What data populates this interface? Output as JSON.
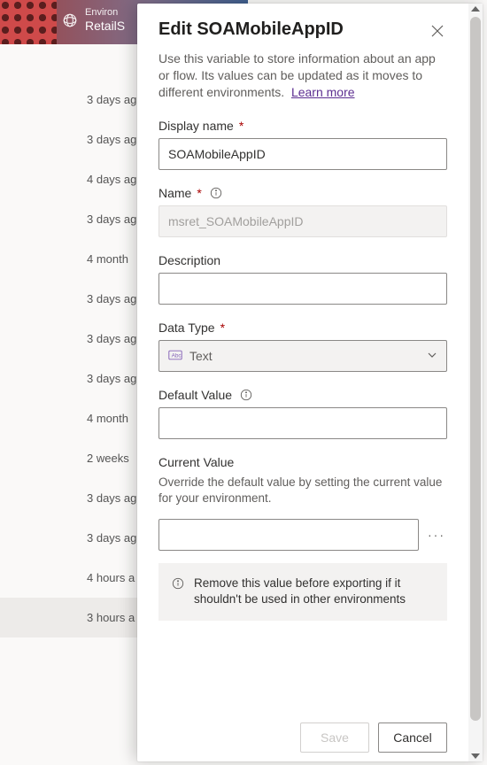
{
  "header": {
    "env_label": "Environ",
    "env_name": "RetailS"
  },
  "bg_rows": [
    {
      "text": "3 days ag",
      "highlight": false
    },
    {
      "text": "3 days ag",
      "highlight": false
    },
    {
      "text": "4 days ag",
      "highlight": false
    },
    {
      "text": "3 days ag",
      "highlight": false
    },
    {
      "text": "4 month",
      "highlight": false
    },
    {
      "text": "3 days ag",
      "highlight": false
    },
    {
      "text": "3 days ag",
      "highlight": false
    },
    {
      "text": "3 days ag",
      "highlight": false
    },
    {
      "text": "4 month",
      "highlight": false
    },
    {
      "text": "2 weeks",
      "highlight": false
    },
    {
      "text": "3 days ag",
      "highlight": false
    },
    {
      "text": "3 days ag",
      "highlight": false
    },
    {
      "text": "4 hours a",
      "highlight": false
    },
    {
      "text": "3 hours a",
      "highlight": true
    }
  ],
  "panel": {
    "title": "Edit SOAMobileAppID",
    "help": "Use this variable to store information about an app or flow. Its values can be updated as it moves to different environments.",
    "learn_more": "Learn more",
    "display_name": {
      "label": "Display name",
      "value": "SOAMobileAppID"
    },
    "name": {
      "label": "Name",
      "value": "msret_SOAMobileAppID"
    },
    "description": {
      "label": "Description",
      "value": ""
    },
    "data_type": {
      "label": "Data Type",
      "selected": "Text"
    },
    "default_value": {
      "label": "Default Value",
      "value": ""
    },
    "current_value": {
      "label": "Current Value",
      "sub": "Override the default value by setting the current value for your environment.",
      "value": "",
      "note": "Remove this value before exporting if it shouldn't be used in other environments"
    },
    "buttons": {
      "save": "Save",
      "cancel": "Cancel"
    }
  }
}
